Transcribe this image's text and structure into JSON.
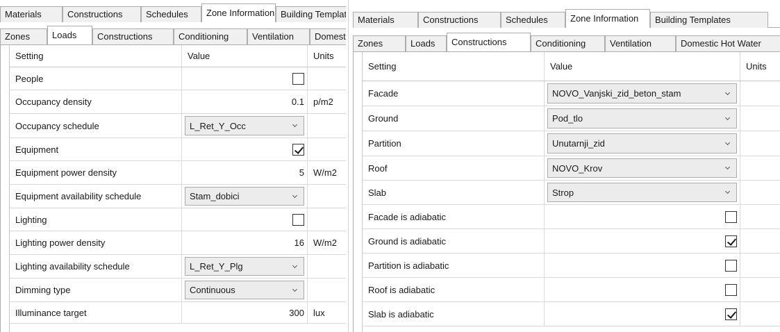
{
  "left": {
    "top_tabs": [
      {
        "label": "Materials"
      },
      {
        "label": "Constructions"
      },
      {
        "label": "Schedules"
      },
      {
        "label": "Zone Information",
        "active": true
      },
      {
        "label": "Building Templates"
      }
    ],
    "sub_tabs": [
      {
        "label": "Zones"
      },
      {
        "label": "Loads",
        "active": true
      },
      {
        "label": "Constructions"
      },
      {
        "label": "Conditioning"
      },
      {
        "label": "Ventilation"
      },
      {
        "label": "Domestic Hot Water"
      }
    ],
    "columns": {
      "setting": "Setting",
      "value": "Value",
      "units": "Units"
    },
    "rows": [
      {
        "setting": "People",
        "kind": "checkbox",
        "checked": false,
        "units": ""
      },
      {
        "setting": "Occupancy density",
        "kind": "number",
        "value": "0.1",
        "units": "p/m2"
      },
      {
        "setting": "Occupancy schedule",
        "kind": "combo",
        "value": "L_Ret_Y_Occ",
        "units": ""
      },
      {
        "setting": "Equipment",
        "kind": "checkbox",
        "checked": true,
        "units": ""
      },
      {
        "setting": "Equipment power density",
        "kind": "number",
        "value": "5",
        "units": "W/m2"
      },
      {
        "setting": "Equipment availability schedule",
        "kind": "combo",
        "value": "Stam_dobici",
        "units": ""
      },
      {
        "setting": "Lighting",
        "kind": "checkbox",
        "checked": false,
        "units": ""
      },
      {
        "setting": "Lighting power density",
        "kind": "number",
        "value": "16",
        "units": "W/m2"
      },
      {
        "setting": "Lighting availability schedule",
        "kind": "combo",
        "value": "L_Ret_Y_Plg",
        "units": ""
      },
      {
        "setting": "Dimming type",
        "kind": "combo",
        "value": "Continuous",
        "units": ""
      },
      {
        "setting": "Illuminance target",
        "kind": "number",
        "value": "300",
        "units": "lux"
      }
    ]
  },
  "right": {
    "top_tabs": [
      {
        "label": "Materials"
      },
      {
        "label": "Constructions"
      },
      {
        "label": "Schedules"
      },
      {
        "label": "Zone Information",
        "active": true
      },
      {
        "label": "Building Templates"
      }
    ],
    "sub_tabs": [
      {
        "label": "Zones"
      },
      {
        "label": "Loads"
      },
      {
        "label": "Constructions",
        "active": true
      },
      {
        "label": "Conditioning"
      },
      {
        "label": "Ventilation"
      },
      {
        "label": "Domestic Hot Water"
      }
    ],
    "columns": {
      "setting": "Setting",
      "value": "Value",
      "units": "Units"
    },
    "rows": [
      {
        "setting": "Facade",
        "kind": "combo",
        "value": "NOVO_Vanjski_zid_beton_stam",
        "units": ""
      },
      {
        "setting": "Ground",
        "kind": "combo",
        "value": "Pod_tlo",
        "units": ""
      },
      {
        "setting": "Partition",
        "kind": "combo",
        "value": "Unutarnji_zid",
        "units": ""
      },
      {
        "setting": "Roof",
        "kind": "combo",
        "value": "NOVO_Krov",
        "units": ""
      },
      {
        "setting": "Slab",
        "kind": "combo",
        "value": "Strop",
        "units": ""
      },
      {
        "setting": "Facade is adiabatic",
        "kind": "checkbox",
        "checked": false,
        "units": ""
      },
      {
        "setting": "Ground is adiabatic",
        "kind": "checkbox",
        "checked": true,
        "units": ""
      },
      {
        "setting": "Partition is adiabatic",
        "kind": "checkbox",
        "checked": false,
        "units": ""
      },
      {
        "setting": "Roof is adiabatic",
        "kind": "checkbox",
        "checked": false,
        "units": ""
      },
      {
        "setting": "Slab is adiabatic",
        "kind": "checkbox",
        "checked": true,
        "units": ""
      }
    ]
  }
}
